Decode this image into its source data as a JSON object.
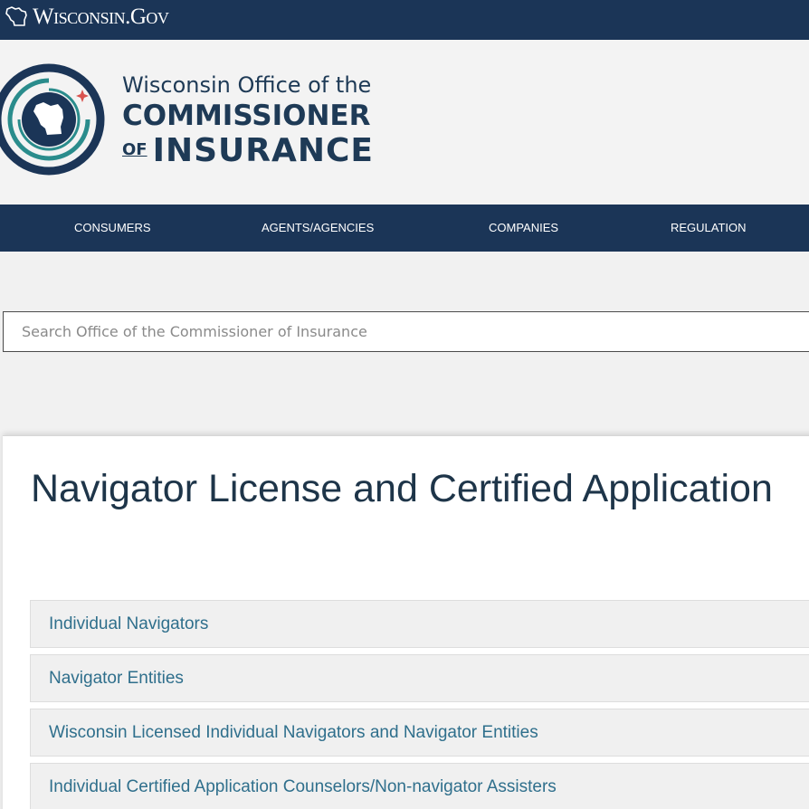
{
  "topbar": {
    "gov_label": "Wisconsin.Gov"
  },
  "brand": {
    "line1": "Wisconsin Office of the",
    "line2": "COMMISSIONER",
    "line3_of": "OF",
    "line3_main": "INSURANCE"
  },
  "nav": {
    "items": [
      {
        "label": "CONSUMERS"
      },
      {
        "label": "AGENTS/AGENCIES"
      },
      {
        "label": "COMPANIES"
      },
      {
        "label": "REGULATION"
      }
    ]
  },
  "search": {
    "placeholder": "Search Office of the Commissioner of Insurance",
    "value": ""
  },
  "main": {
    "title": "Navigator License and Certified Application",
    "accordion": [
      {
        "label": "Individual Navigators"
      },
      {
        "label": "Navigator Entities"
      },
      {
        "label": "Wisconsin Licensed Individual Navigators and Navigator Entities"
      },
      {
        "label": "Individual Certified Application Counselors/Non-navigator Assisters"
      }
    ]
  },
  "colors": {
    "navy": "#1b3557",
    "teal": "#2a8c8c",
    "link": "#2f6f8c",
    "accent_star": "#d9534f"
  }
}
